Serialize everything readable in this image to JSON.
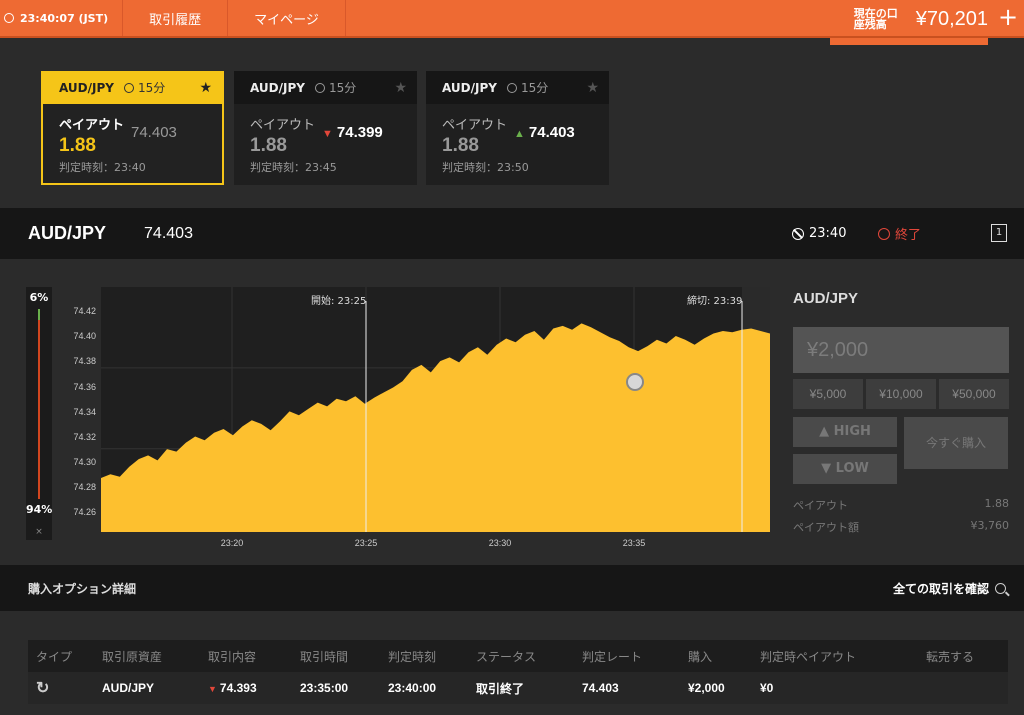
{
  "header": {
    "clock": "23:40:07 (JST)",
    "nav": [
      "取引履歴",
      "マイページ"
    ],
    "balance_label": "現在の口座残高",
    "balance_value": "¥70,201",
    "plus": "+"
  },
  "tiles": [
    {
      "pair": "AUD/JPY",
      "period": "15分",
      "payout_label": "ペイアウト",
      "payout": "1.88",
      "rate": "74.403",
      "rate_dir": "",
      "judge": "判定時刻：23:40",
      "active": true
    },
    {
      "pair": "AUD/JPY",
      "period": "15分",
      "payout_label": "ペイアウト",
      "payout": "1.88",
      "rate": "74.399",
      "rate_dir": "down",
      "judge": "判定時刻：23:45",
      "active": false
    },
    {
      "pair": "AUD/JPY",
      "period": "15分",
      "payout_label": "ペイアウト",
      "payout": "1.88",
      "rate": "74.403",
      "rate_dir": "up",
      "judge": "判定時刻：23:50",
      "active": false
    }
  ],
  "asset": {
    "name": "AUD/JPY",
    "rate": "74.403",
    "time": "23:40",
    "status": "終了"
  },
  "gauge": {
    "high_pct": "6%",
    "low_pct": "94%",
    "close": "×",
    "high_fraction": 0.06
  },
  "chart_data": {
    "type": "area",
    "yticks": [
      "74.42",
      "74.40",
      "74.38",
      "74.36",
      "74.34",
      "74.32",
      "74.30",
      "74.28",
      "74.26"
    ],
    "ylim": [
      74.245,
      74.44
    ],
    "xticks": [
      "23:20",
      "23:25",
      "23:30",
      "23:35"
    ],
    "start_label": "開始: 23:25",
    "end_label": "締切: 23:39",
    "series": [
      {
        "values": [
          74.288,
          74.291,
          74.289,
          74.297,
          74.303,
          74.306,
          74.302,
          74.311,
          74.309,
          74.316,
          74.321,
          74.318,
          74.324,
          74.327,
          74.322,
          74.329,
          74.334,
          74.331,
          74.326,
          74.333,
          74.341,
          74.338,
          74.343,
          74.348,
          74.345,
          74.351,
          74.349,
          74.353,
          74.347,
          74.352,
          74.356,
          74.36,
          74.365,
          74.374,
          74.378,
          74.372,
          74.381,
          74.384,
          74.38,
          74.388,
          74.392,
          74.386,
          74.394,
          74.399,
          74.396,
          74.402,
          74.405,
          74.398,
          74.407,
          74.409,
          74.406,
          74.411,
          74.408,
          74.404,
          74.4,
          74.397,
          74.392,
          74.389,
          74.393,
          74.398,
          74.395,
          74.401,
          74.398,
          74.394,
          74.399,
          74.403,
          74.405,
          74.404,
          74.406,
          74.407,
          74.405,
          74.403
        ]
      }
    ],
    "color": "#fdc02f"
  },
  "order": {
    "title": "AUD/JPY",
    "amount": "¥2,000",
    "presets": [
      "¥5,000",
      "¥10,000",
      "¥50,000"
    ],
    "high": "HIGH",
    "low": "LOW",
    "buy_now": "今すぐ購入",
    "payout_label": "ペイアウト",
    "payout_value": "1.88",
    "payout_amount_label": "ペイアウト額",
    "payout_amount_value": "¥3,760"
  },
  "details": {
    "title": "購入オプション詳細",
    "view_all": "全ての取引を確認",
    "columns": [
      "タイプ",
      "取引原資産",
      "取引内容",
      "取引時間",
      "判定時刻",
      "ステータス",
      "判定レート",
      "購入",
      "判定時ペイアウト",
      "転売する"
    ],
    "rows": [
      {
        "asset": "AUD/JPY",
        "content": "74.393",
        "trade_time": "23:35:00",
        "judge_time": "23:40:00",
        "status": "取引終了",
        "judge_rate": "74.403",
        "purchase": "¥2,000",
        "payout": "¥0",
        "resell": ""
      }
    ]
  }
}
